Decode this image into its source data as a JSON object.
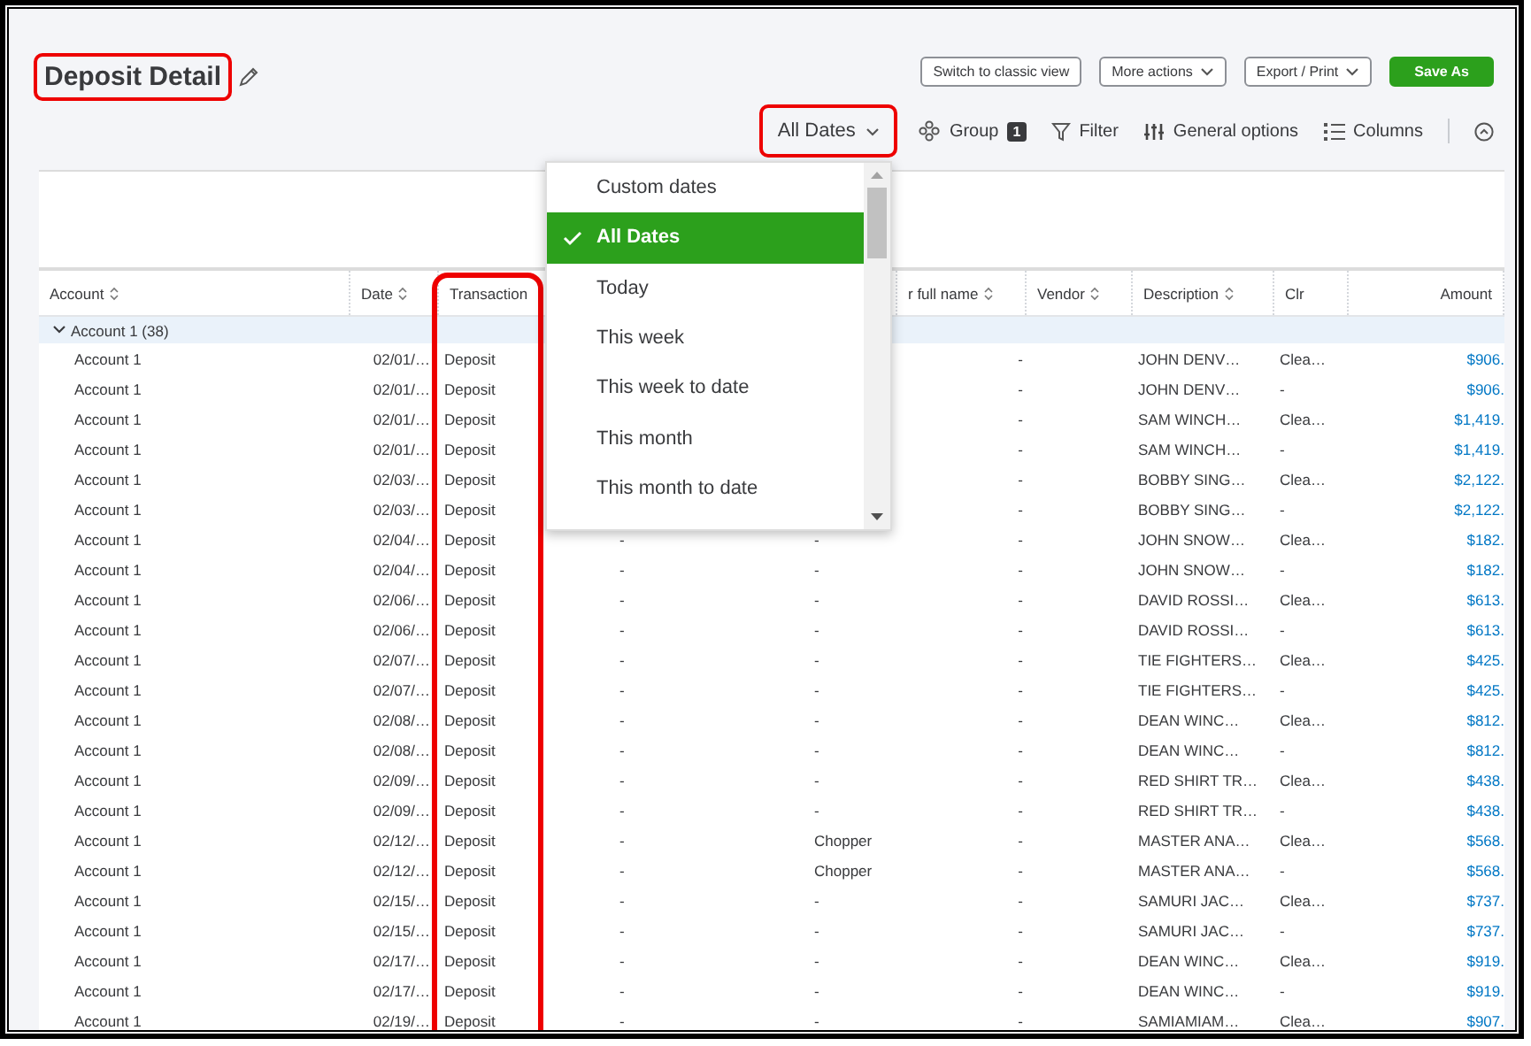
{
  "title": {
    "text": "Deposit Detail",
    "highlighted": true
  },
  "actions": [
    {
      "label": "Switch to classic view",
      "kind": "outline"
    },
    {
      "label": "More actions",
      "kind": "menu"
    },
    {
      "label": "Export / Print",
      "kind": "menu"
    },
    {
      "label": "Save As",
      "kind": "primary"
    }
  ],
  "toolbar": {
    "date_filter": {
      "label": "All Dates",
      "highlighted": true,
      "expanded": true
    },
    "items": [
      {
        "kind": "group",
        "label": "Group",
        "badge": "1"
      },
      {
        "kind": "filter",
        "label": "Filter"
      },
      {
        "kind": "options",
        "label": "General options"
      },
      {
        "kind": "columns",
        "label": "Columns"
      },
      {
        "kind": "collapse"
      }
    ]
  },
  "date_menu": [
    {
      "label": "Custom dates",
      "selected": false
    },
    {
      "label": "All Dates",
      "selected": true
    },
    {
      "label": "Today",
      "selected": false
    },
    {
      "label": "This week",
      "selected": false
    },
    {
      "label": "This week to date",
      "selected": false
    },
    {
      "label": "This month",
      "selected": false
    },
    {
      "label": "This month to date",
      "selected": false
    }
  ],
  "table": {
    "columns": [
      {
        "label": "Account",
        "sortable": true
      },
      {
        "label": "Date",
        "sortable": true
      },
      {
        "label": "Transaction",
        "sortable": false,
        "highlighted": true
      },
      {},
      {},
      {
        "label": "r full name",
        "sortable": true
      },
      {
        "label": "Vendor",
        "sortable": true
      },
      {
        "label": "Description",
        "sortable": true
      },
      {
        "label": "Clr",
        "sortable": false
      },
      {
        "label": "Amount",
        "sortable": false
      }
    ],
    "group": {
      "label": "Account 1 (38)",
      "expanded": true
    },
    "rows": [
      [
        "Account 1",
        "02/01/…",
        "Deposit",
        null,
        null,
        "-",
        null,
        "JOHN DENV…",
        "Clea…",
        "$906."
      ],
      [
        "Account 1",
        "02/01/…",
        "Deposit",
        null,
        null,
        "-",
        null,
        "JOHN DENV…",
        "-",
        "$906."
      ],
      [
        "Account 1",
        "02/01/…",
        "Deposit",
        null,
        null,
        "-",
        null,
        "SAM WINCH…",
        "Clea…",
        "$1,419."
      ],
      [
        "Account 1",
        "02/01/…",
        "Deposit",
        null,
        null,
        "-",
        null,
        "SAM WINCH…",
        "-",
        "$1,419."
      ],
      [
        "Account 1",
        "02/03/…",
        "Deposit",
        null,
        null,
        "-",
        null,
        "BOBBY SING…",
        "Clea…",
        "$2,122."
      ],
      [
        "Account 1",
        "02/03/…",
        "Deposit",
        null,
        null,
        "-",
        null,
        "BOBBY SING…",
        "-",
        "$2,122."
      ],
      [
        "Account 1",
        "02/04/…",
        "Deposit",
        "-",
        "-",
        "-",
        null,
        "JOHN SNOW…",
        "Clea…",
        "$182."
      ],
      [
        "Account 1",
        "02/04/…",
        "Deposit",
        "-",
        "-",
        "-",
        null,
        "JOHN SNOW…",
        "-",
        "$182."
      ],
      [
        "Account 1",
        "02/06/…",
        "Deposit",
        "-",
        "-",
        "-",
        null,
        "DAVID ROSSI…",
        "Clea…",
        "$613."
      ],
      [
        "Account 1",
        "02/06/…",
        "Deposit",
        "-",
        "-",
        "-",
        null,
        "DAVID ROSSI…",
        "-",
        "$613."
      ],
      [
        "Account 1",
        "02/07/…",
        "Deposit",
        "-",
        "-",
        "-",
        null,
        "TIE FIGHTERS…",
        "Clea…",
        "$425."
      ],
      [
        "Account 1",
        "02/07/…",
        "Deposit",
        "-",
        "-",
        "-",
        null,
        "TIE FIGHTERS…",
        "-",
        "$425."
      ],
      [
        "Account 1",
        "02/08/…",
        "Deposit",
        "-",
        "-",
        "-",
        null,
        "DEAN WINC…",
        "Clea…",
        "$812."
      ],
      [
        "Account 1",
        "02/08/…",
        "Deposit",
        "-",
        "-",
        "-",
        null,
        "DEAN WINC…",
        "-",
        "$812."
      ],
      [
        "Account 1",
        "02/09/…",
        "Deposit",
        "-",
        "-",
        "-",
        null,
        "RED SHIRT TR…",
        "Clea…",
        "$438."
      ],
      [
        "Account 1",
        "02/09/…",
        "Deposit",
        "-",
        "-",
        "-",
        null,
        "RED SHIRT TR…",
        "-",
        "$438."
      ],
      [
        "Account 1",
        "02/12/…",
        "Deposit",
        "-",
        "Chopper",
        "-",
        null,
        "MASTER ANA…",
        "Clea…",
        "$568."
      ],
      [
        "Account 1",
        "02/12/…",
        "Deposit",
        "-",
        "Chopper",
        "-",
        null,
        "MASTER ANA…",
        "-",
        "$568."
      ],
      [
        "Account 1",
        "02/15/…",
        "Deposit",
        "-",
        "-",
        "-",
        null,
        "SAMURI JAC…",
        "Clea…",
        "$737."
      ],
      [
        "Account 1",
        "02/15/…",
        "Deposit",
        "-",
        "-",
        "-",
        null,
        "SAMURI JAC…",
        "-",
        "$737."
      ],
      [
        "Account 1",
        "02/17/…",
        "Deposit",
        "-",
        "-",
        "-",
        null,
        "DEAN WINC…",
        "Clea…",
        "$919."
      ],
      [
        "Account 1",
        "02/17/…",
        "Deposit",
        "-",
        "-",
        "-",
        null,
        "DEAN WINC…",
        "-",
        "$919."
      ],
      [
        "Account 1",
        "02/19/…",
        "Deposit",
        "-",
        "-",
        "-",
        null,
        "SAMIAMIAM…",
        "Clea…",
        "$907."
      ]
    ]
  }
}
